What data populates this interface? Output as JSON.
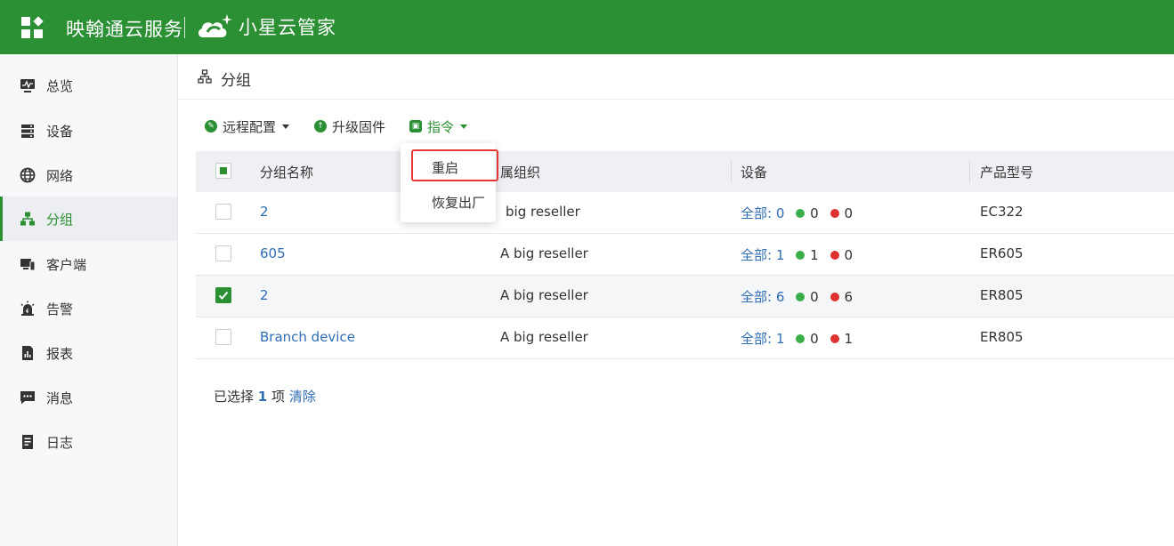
{
  "header": {
    "brand": "映翰通云服务",
    "product": "小星云管家"
  },
  "sidebar": {
    "items": [
      {
        "label": "总览",
        "icon": "monitor-icon"
      },
      {
        "label": "设备",
        "icon": "server-icon"
      },
      {
        "label": "网络",
        "icon": "globe-icon"
      },
      {
        "label": "分组",
        "icon": "sitemap-icon",
        "active": true
      },
      {
        "label": "客户端",
        "icon": "devices-icon"
      },
      {
        "label": "告警",
        "icon": "alarm-icon"
      },
      {
        "label": "报表",
        "icon": "report-icon"
      },
      {
        "label": "消息",
        "icon": "message-icon"
      },
      {
        "label": "日志",
        "icon": "log-icon"
      }
    ]
  },
  "page": {
    "title": "分组"
  },
  "toolbar": {
    "remote_config": "远程配置",
    "upgrade_firmware": "升级固件",
    "command": "指令"
  },
  "command_menu": {
    "items": [
      "重启",
      "恢复出厂"
    ]
  },
  "table": {
    "columns": [
      "分组名称",
      "所属组织",
      "设备",
      "产品型号"
    ],
    "org_partial_visible": "属组织",
    "total_label": "全部:",
    "rows": [
      {
        "name": "2",
        "org": "A big reseller",
        "org_visible": "big reseller",
        "total": "0",
        "online": "0",
        "offline": "0",
        "model": "EC322",
        "checked": false
      },
      {
        "name": "605",
        "org": "A big reseller",
        "total": "1",
        "online": "1",
        "offline": "0",
        "model": "ER605",
        "checked": false
      },
      {
        "name": "2",
        "org": "A big reseller",
        "total": "6",
        "online": "0",
        "offline": "6",
        "model": "ER805",
        "checked": true
      },
      {
        "name": "Branch device",
        "org": "A big reseller",
        "total": "1",
        "online": "0",
        "offline": "1",
        "model": "ER805",
        "checked": false
      }
    ]
  },
  "selection": {
    "prefix": "已选择",
    "count": "1",
    "unit": "项",
    "clear": "清除"
  },
  "colors": {
    "brand_green": "#2b8f34",
    "link_blue": "#2f6db5",
    "online_dot": "#3aae49",
    "offline_dot": "#e03131",
    "highlight_red": "#e53935"
  }
}
